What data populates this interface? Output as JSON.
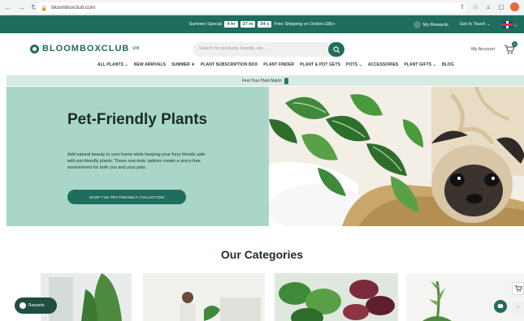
{
  "browser": {
    "url": "bloomboxclub.com",
    "back_icon": "back-arrow-icon",
    "forward_icon": "forward-arrow-icon",
    "reload_icon": "reload-icon"
  },
  "promo": {
    "label": "Summer Special",
    "hours": "4 hr",
    "minutes": "27 m",
    "seconds": "34 s",
    "shipping": "Free Shipping on Orders £85+",
    "rewards": "My Rewards",
    "contact": "Get In Touch",
    "color": "#1f6d5c"
  },
  "header": {
    "logo_text": "BLOOMBOXCLUB",
    "logo_sup": "UK",
    "search_placeholder": "Search for products, brands, etc...",
    "account": "My Account",
    "cart_count": "0"
  },
  "nav": {
    "items": [
      "ALL PLANTS ⌄",
      "NEW ARRIVALS",
      "SUMMER ☀",
      "PLANT SUBSCRIPTION BOX",
      "PLANT FINDER",
      "PLANT & POT GETS",
      "POTS ⌄",
      "ACCESSORIES",
      "PLANT GIFTS ⌄",
      "BLOG"
    ]
  },
  "finder": {
    "text": "Find Your Plant Match"
  },
  "hero": {
    "title": "Pet-Friendly Plants",
    "text": "Add natural beauty to your home while keeping your furry friends safe with pet-friendly plants. These non-toxic options create a worry-free environment for both you and your pets.",
    "button": "SHOP THE PET-FRIENDLY COLLECTION",
    "bg": "#a9d6c8"
  },
  "categories": {
    "title": "Our Categories"
  },
  "floating": {
    "rewards": "Rewards",
    "cart_count": "0"
  }
}
